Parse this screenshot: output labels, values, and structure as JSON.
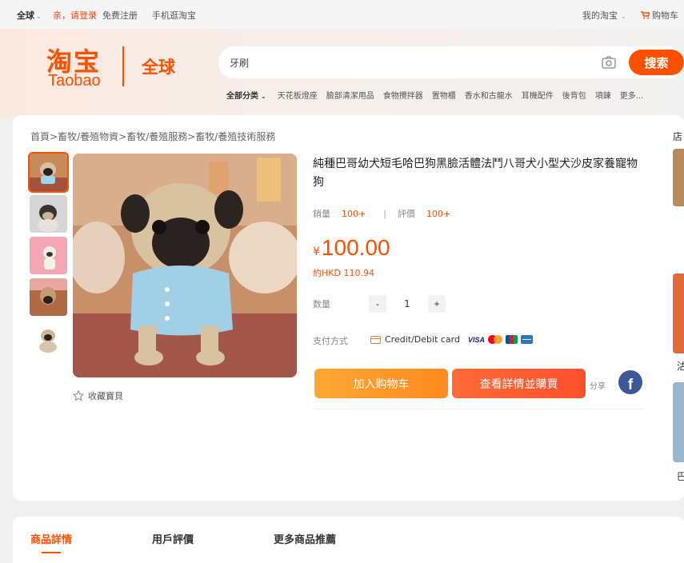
{
  "topbar": {
    "region": "全球",
    "login": "亲，请登录",
    "register": "免费注册",
    "mobile": "手机逛淘宝",
    "my_taobao": "我的淘宝",
    "cart": "购物车"
  },
  "header": {
    "logo_cn": "淘宝",
    "logo_en": "Taobao",
    "logo_global": "全球",
    "search_value": "牙刷",
    "search_button": "搜索",
    "categories_all": "全部分类",
    "categories": [
      "天花板燈座",
      "臉部清潔用品",
      "食物攪拌器",
      "置物櫃",
      "香水和古龍水",
      "耳機配件",
      "後背包",
      "項鍊",
      "更多..."
    ]
  },
  "breadcrumb": [
    "首頁",
    "畜牧/養殖物資",
    "畜牧/養殖服務",
    "畜牧/養殖技術服務"
  ],
  "breadcrumb_sep": ">",
  "product": {
    "title": "純種巴哥幼犬短毛哈巴狗黑臉活體法鬥八哥犬小型犬沙皮家養寵物狗",
    "sales_label": "銷量",
    "sales_value": "100+",
    "reviews_label": "評價",
    "reviews_value": "100+",
    "currency": "¥",
    "price": "100.00",
    "price_hkd": "約HKD 110.94",
    "qty_label": "数量",
    "qty_value": "1",
    "qty_minus": "-",
    "qty_plus": "+",
    "payment_label": "支付方式",
    "payment_method": "Credit/Debit card",
    "visa": "VISA",
    "favorite": "收藏寶貝",
    "add_to_cart": "加入购物车",
    "buy": "查看詳情並購買",
    "share": "分享",
    "facebook": "f"
  },
  "side": {
    "store_label": "店",
    "text_1": "沽",
    "text_2": "巴"
  },
  "tabs": [
    "商品詳情",
    "用戶評價",
    "更多商品推薦"
  ],
  "colors": {
    "accent": "#ff5000",
    "cart_button": "#ff9a26",
    "buy_button": "#ff5a30",
    "facebook": "#3b5998"
  },
  "icons": [
    "camera-icon",
    "cart-icon",
    "star-icon",
    "credit-card-icon",
    "facebook-icon",
    "chevron-down-icon"
  ]
}
